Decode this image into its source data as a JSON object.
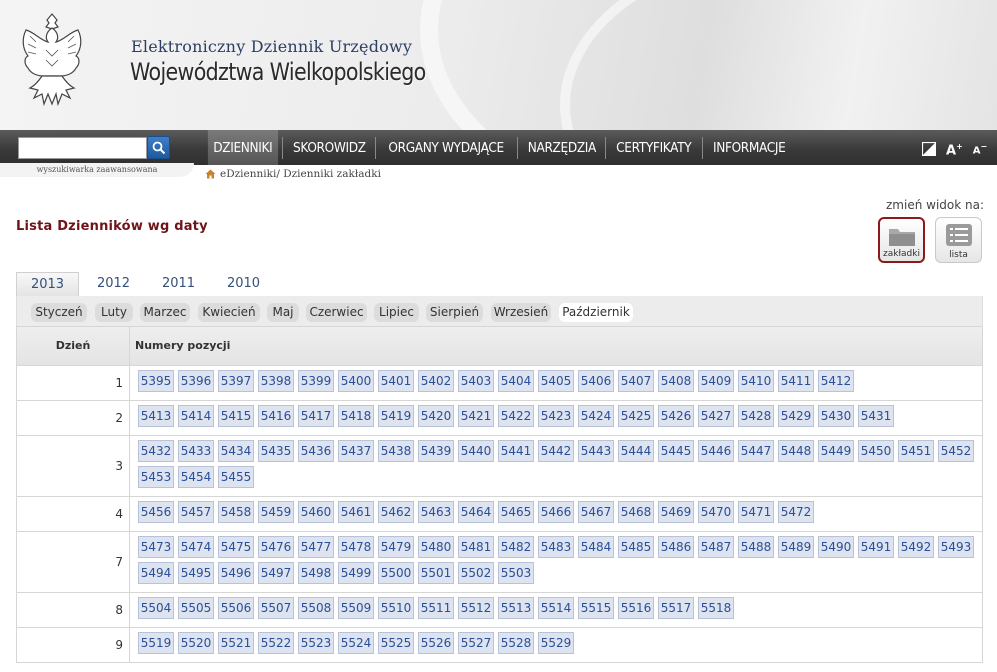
{
  "header": {
    "line1": "Elektroniczny Dziennik Urzędowy",
    "line2": "Województwa Wielkopolskiego",
    "emblem_icon": "white-eagle-emblem-icon"
  },
  "search": {
    "value": "",
    "adv_label": "wyszukiwarka zaawansowana"
  },
  "nav": {
    "items": [
      "DZIENNIKI",
      "SKOROWIDZ",
      "ORGANY WYDAJĄCE",
      "NARZĘDZIA",
      "CERTYFIKATY",
      "INFORMACJE"
    ],
    "active_index": 0,
    "tools": {
      "contrast_icon": "contrast-icon",
      "font_increase": "A",
      "font_decrease": "A"
    }
  },
  "breadcrumb": {
    "text": "eDzienniki/ Dzienniki zakładki",
    "icon": "home-icon"
  },
  "page_title": "Lista Dzienników wg daty",
  "view": {
    "label": "zmień widok na:",
    "buttons": [
      {
        "label": "zakładki",
        "icon": "folder-icon",
        "active": true
      },
      {
        "label": "lista",
        "icon": "list-icon",
        "active": false
      }
    ]
  },
  "years": {
    "items": [
      "2013",
      "2012",
      "2011",
      "2010"
    ],
    "active_index": 0
  },
  "months": {
    "items": [
      "Styczeń",
      "Luty",
      "Marzec",
      "Kwiecień",
      "Maj",
      "Czerwiec",
      "Lipiec",
      "Sierpień",
      "Wrzesień",
      "Październik"
    ],
    "active_index": 9
  },
  "table": {
    "col_day": "Dzień",
    "col_numbers": "Numery pozycji",
    "rows": [
      {
        "day": "1",
        "items": [
          "5395",
          "5396",
          "5397",
          "5398",
          "5399",
          "5400",
          "5401",
          "5402",
          "5403",
          "5404",
          "5405",
          "5406",
          "5407",
          "5408",
          "5409",
          "5410",
          "5411",
          "5412"
        ]
      },
      {
        "day": "2",
        "items": [
          "5413",
          "5414",
          "5415",
          "5416",
          "5417",
          "5418",
          "5419",
          "5420",
          "5421",
          "5422",
          "5423",
          "5424",
          "5425",
          "5426",
          "5427",
          "5428",
          "5429",
          "5430",
          "5431"
        ]
      },
      {
        "day": "3",
        "items": [
          "5432",
          "5433",
          "5434",
          "5435",
          "5436",
          "5437",
          "5438",
          "5439",
          "5440",
          "5441",
          "5442",
          "5443",
          "5444",
          "5445",
          "5446",
          "5447",
          "5448",
          "5449",
          "5450",
          "5451",
          "5452",
          "5453",
          "5454",
          "5455"
        ]
      },
      {
        "day": "4",
        "items": [
          "5456",
          "5457",
          "5458",
          "5459",
          "5460",
          "5461",
          "5462",
          "5463",
          "5464",
          "5465",
          "5466",
          "5467",
          "5468",
          "5469",
          "5470",
          "5471",
          "5472"
        ]
      },
      {
        "day": "7",
        "items": [
          "5473",
          "5474",
          "5475",
          "5476",
          "5477",
          "5478",
          "5479",
          "5480",
          "5481",
          "5482",
          "5483",
          "5484",
          "5485",
          "5486",
          "5487",
          "5488",
          "5489",
          "5490",
          "5491",
          "5492",
          "5493",
          "5494",
          "5495",
          "5496",
          "5497",
          "5498",
          "5499",
          "5500",
          "5501",
          "5502",
          "5503"
        ]
      },
      {
        "day": "8",
        "items": [
          "5504",
          "5505",
          "5506",
          "5507",
          "5508",
          "5509",
          "5510",
          "5511",
          "5512",
          "5513",
          "5514",
          "5515",
          "5516",
          "5517",
          "5518"
        ]
      },
      {
        "day": "9",
        "items": [
          "5519",
          "5520",
          "5521",
          "5522",
          "5523",
          "5524",
          "5525",
          "5526",
          "5527",
          "5528",
          "5529"
        ]
      }
    ]
  },
  "colors": {
    "title": "#6f1419",
    "chip_text": "#2a4f9a",
    "chip_bg": "#dde3ef",
    "nav_bg": "#3a3a3a"
  }
}
